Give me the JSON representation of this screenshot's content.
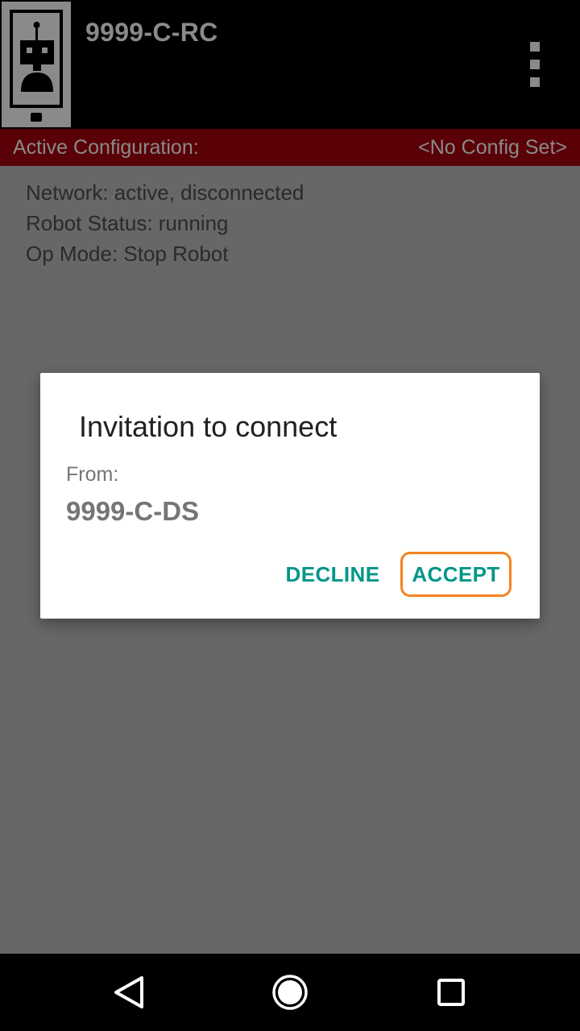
{
  "app_bar": {
    "title": "9999-C-RC",
    "logo_icon": "robot-phone-icon",
    "menu_icon": "overflow-menu-icon"
  },
  "config_bar": {
    "label": "Active Configuration:",
    "value": "<No Config Set>"
  },
  "status": {
    "network": "Network: active, disconnected",
    "robot_status": "Robot Status: running",
    "op_mode": "Op Mode: Stop Robot"
  },
  "dialog": {
    "title": "Invitation to connect",
    "from_label": "From:",
    "from_device": "9999-C-DS",
    "decline_label": "DECLINE",
    "accept_label": "ACCEPT"
  },
  "nav_bar": {
    "back_icon": "back-triangle-icon",
    "home_icon": "home-circle-icon",
    "recents_icon": "recents-square-icon"
  },
  "colors": {
    "app_bar_bg": "#000000",
    "config_bar_bg": "#5a0007",
    "scrim_bg": "#676767",
    "button_text": "#009688",
    "accept_highlight": "#f5821f"
  }
}
